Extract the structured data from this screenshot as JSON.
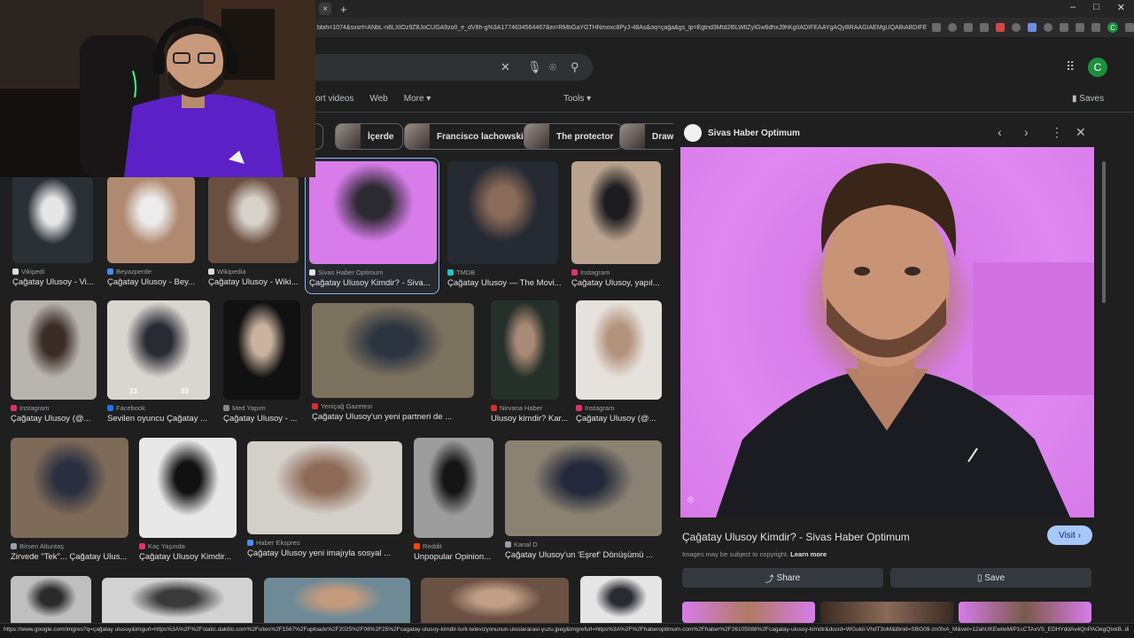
{
  "browser": {
    "url": "bbih=1074&sxsrf=ANbL-n6LXtOz9Z8JoCUGA9zo0_e_dV8h-g%3A1774634564467&ei=RMbGaYGTHNmoxc8PyJ-48As&oq=çağa&gs_lp=Egtnd3Mtd2l6LWltZyIGw6dhxJ9hKgIIADIFEAAYgAQyBRAAGIAEMgUQABiABDIFEAAYgAQy...",
    "new_tab": "+",
    "tab_close": "×",
    "window_controls": [
      "–",
      "□",
      "✕"
    ],
    "profile_initial": "C"
  },
  "search": {
    "avatar_initial": "C",
    "filter_tabs": [
      "ort videos",
      "Web",
      "More ▾"
    ],
    "tools_label": "Tools ▾",
    "saves_label": "Saves"
  },
  "chips": [
    {
      "label": "lly"
    },
    {
      "label": "İçerde"
    },
    {
      "label": "Francisco lachowski"
    },
    {
      "label": "The protector"
    },
    {
      "label": "Drawi"
    }
  ],
  "results": [
    {
      "source": "Vikipedi",
      "caption": "Çağatay Ulusoy - Vi...",
      "fav": "#dcdcdc"
    },
    {
      "source": "Beyazperde",
      "caption": "Çağatay Ulusoy - Bey...",
      "fav": "#4a8cf5"
    },
    {
      "source": "Wikipedia",
      "caption": "Çağatay Ulusoy - Wiki...",
      "fav": "#dcdcdc"
    },
    {
      "source": "Sivas Haber Optimum",
      "caption": "Çağatay Ulusoy Kimdir? - Siva...",
      "fav": "#e3e3e3"
    },
    {
      "source": "TMDB",
      "caption": "Çağatay Ulusoy — The Movi...",
      "fav": "#1ec6d3"
    },
    {
      "source": "Instagram",
      "caption": "Çağatay Ulusoy, yapıl...",
      "fav": "#e1306c"
    },
    {
      "source": "Instagram",
      "caption": "Çağatay Ulusoy (@...",
      "fav": "#e1306c"
    },
    {
      "source": "Facebook",
      "caption": "Sevilen oyuncu Çağatay ...",
      "fav": "#1877f2"
    },
    {
      "source": "Med Yapım",
      "caption": "Çağatay Ulusoy - ...",
      "fav": "#888888"
    },
    {
      "source": "Yeniçağ Gazetesi",
      "caption": "Çağatay Ulusoy'un yeni partneri de ...",
      "fav": "#d32f2f"
    },
    {
      "source": "Nirvana Haber",
      "caption": "Ulusoy kimdir? Kar...",
      "fav": "#d32f2f"
    },
    {
      "source": "Instagram",
      "caption": "Çağatay Ulusoy (@...",
      "fav": "#e1306c"
    },
    {
      "source": "Birsen Altuntaş",
      "caption": "Zirvede \"Tek\"... Çağatay Ulus...",
      "fav": "#9aa0a6"
    },
    {
      "source": "Kaç Yaşında",
      "caption": "Çağatay Ulusoy Kimdir...",
      "fav": "#e1306c"
    },
    {
      "source": "Haber Ekspres",
      "caption": "Çağatay Ulusoy yeni imajıyla sosyal ...",
      "fav": "#4a8cf5"
    },
    {
      "source": "Reddit",
      "caption": "Unpopular Opinion...",
      "fav": "#ff4500"
    },
    {
      "source": "Kanal D",
      "caption": "Çağatay Ulusoy'un 'Eşref' Dönüşümü ...",
      "fav": "#9aa0a6"
    }
  ],
  "thumb_badges": [
    "23",
    "33"
  ],
  "panel": {
    "site": "Sivas Haber Optimum",
    "title": "Çağatay Ulusoy Kimdir? - Sivas Haber Optimum",
    "visit_label": "Visit",
    "copyright": "Images may be subject to copyright.",
    "learn_more": "Learn more",
    "share_label": "Share",
    "save_label": "Save"
  },
  "status_url": "https://www.google.com/imgres?q=çağatay ulusoy&imgurl=https%3A%2F%2Fstatic.daktilo.com%2Fsites%2F1567%2Fuploads%2F2025%2F08%2F25%2Fcagatay-ulusoy-kimdir-turk-televizyonunun-uluslararasi-yuzu.jpeg&imgrefurl=https%3A%2F%2Fhaberoptimum.com%2Fhaber%2F26105088%2Fcagatay-ulusoy-kimdir&docid=WGukil-VhdT3oM&tbnid=SBG09-zn0fxA_M&vet=12ahUKEwiIeMiP1cCTAxVS_EDHYddAv4QnPAOegQIxkB..i&w=1080&h=964&hcb=2&ved=...",
  "colors": {
    "page_bg": "#1f1f1f",
    "visit_bg": "#a8c7fa",
    "action_bg": "#35393d",
    "panel_photo_bg": "#e088f0"
  }
}
